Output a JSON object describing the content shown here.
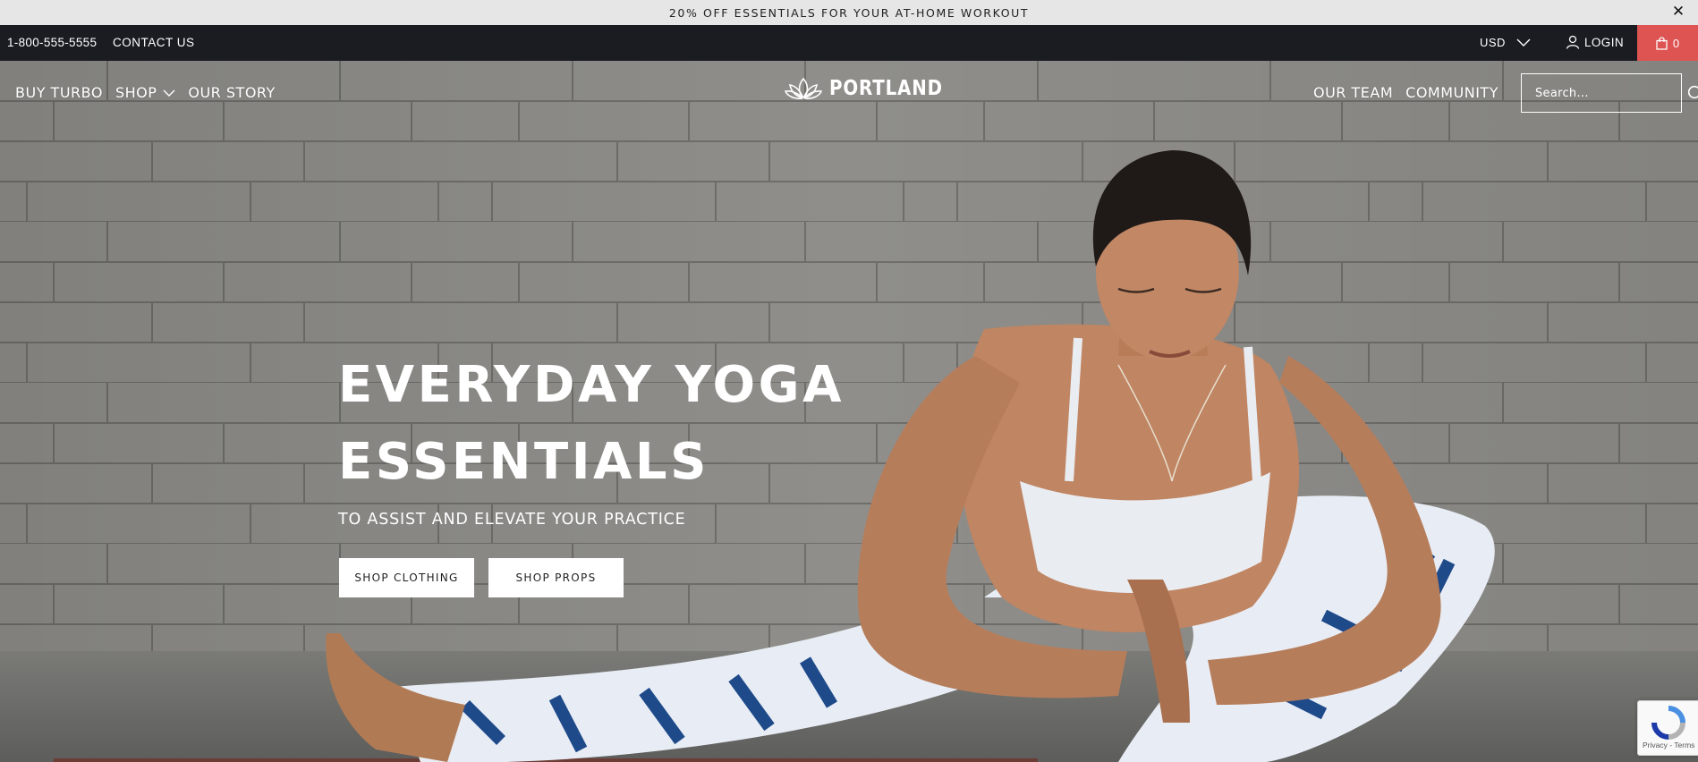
{
  "announcement": {
    "text": "20% OFF ESSENTIALS FOR YOUR AT-HOME WORKOUT"
  },
  "utility_bar": {
    "phone": "1-800-555-5555",
    "contact_label": "CONTACT US",
    "currency": "USD",
    "login_label": "LOGIN",
    "cart_count": "0"
  },
  "header": {
    "nav_left": [
      {
        "label": "BUY TURBO"
      },
      {
        "label": "SHOP"
      },
      {
        "label": "OUR STORY"
      }
    ],
    "logo_text": "PORTLAND",
    "nav_right": [
      {
        "label": "OUR TEAM"
      },
      {
        "label": "COMMUNITY"
      }
    ],
    "search_placeholder": "Search..."
  },
  "hero": {
    "headline_line1": "EVERYDAY YOGA",
    "headline_line2": "ESSENTIALS",
    "subheadline": "TO ASSIST AND ELEVATE YOUR PRACTICE",
    "button_clothing": "SHOP CLOTHING",
    "button_props": "SHOP PROPS"
  },
  "recaptcha": {
    "terms": "Privacy - Terms"
  },
  "colors": {
    "utility_bg": "#1a1c22",
    "cart_bg": "#dd5452",
    "announce_bg": "#e6e6e6"
  }
}
